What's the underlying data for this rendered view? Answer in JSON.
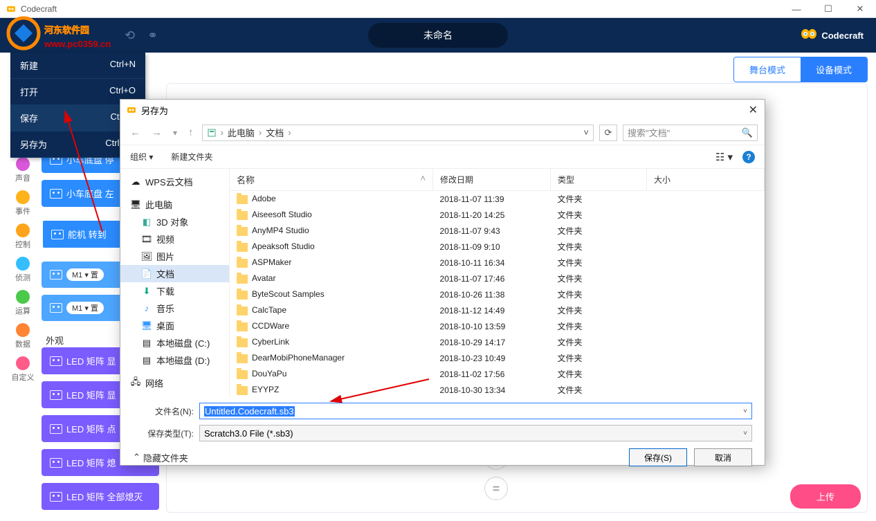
{
  "app": {
    "title": "Codecraft",
    "brand": "Codecraft"
  },
  "header": {
    "project_name": "未命名"
  },
  "mode_tabs": {
    "stage": "舞台模式",
    "device": "设备模式"
  },
  "file_menu": [
    {
      "label": "新建",
      "shortcut": "Ctrl+N"
    },
    {
      "label": "打开",
      "shortcut": "Ctrl+O"
    },
    {
      "label": "保存",
      "shortcut": "Ctrl+S"
    },
    {
      "label": "另存为",
      "shortcut": "Ctrl+Sh"
    }
  ],
  "categories": [
    {
      "label": "外观",
      "color": "#b566ff"
    },
    {
      "label": "声音",
      "color": "#d957d9"
    },
    {
      "label": "事件",
      "color": "#ffb31a"
    },
    {
      "label": "控制",
      "color": "#ffa31a"
    },
    {
      "label": "侦测",
      "color": "#33bfff"
    },
    {
      "label": "运算",
      "color": "#4ac94a"
    },
    {
      "label": "数据",
      "color": "#ff8533"
    },
    {
      "label": "自定义",
      "color": "#ff5c8a"
    }
  ],
  "blocks": {
    "car_stop": "小车底盘 停",
    "car_left": "小车底盘 左",
    "servo": "舵机 转到",
    "m1a": "M1 ▾  置",
    "m1b": "M1 ▾  置",
    "section_appearance": "外观",
    "led1": "LED 矩阵 显",
    "led2": "LED 矩阵 显",
    "led3": "LED 矩阵 点",
    "led4": "LED 矩阵 熄",
    "led5": "LED 矩阵 全部熄灭"
  },
  "upload": "上传",
  "dialog": {
    "title": "另存为",
    "path": {
      "p1": "此电脑",
      "p2": "文档"
    },
    "search_placeholder": "搜索\"文档\"",
    "toolbar": {
      "organize": "组织 ▾",
      "new_folder": "新建文件夹"
    },
    "tree": {
      "wps": "WPS云文档",
      "this_pc": "此电脑",
      "objects3d": "3D 对象",
      "videos": "视频",
      "pictures": "图片",
      "documents": "文档",
      "downloads": "下载",
      "music": "音乐",
      "desktop": "桌面",
      "drive_c": "本地磁盘 (C:)",
      "drive_d": "本地磁盘 (D:)",
      "network": "网络"
    },
    "columns": {
      "name": "名称",
      "date": "修改日期",
      "type": "类型",
      "size": "大小"
    },
    "files": [
      {
        "name": "Adobe",
        "date": "2018-11-07 11:39",
        "type": "文件夹"
      },
      {
        "name": "Aiseesoft Studio",
        "date": "2018-11-20 14:25",
        "type": "文件夹"
      },
      {
        "name": "AnyMP4 Studio",
        "date": "2018-11-07 9:43",
        "type": "文件夹"
      },
      {
        "name": "Apeaksoft Studio",
        "date": "2018-11-09 9:10",
        "type": "文件夹"
      },
      {
        "name": "ASPMaker",
        "date": "2018-10-11 16:34",
        "type": "文件夹"
      },
      {
        "name": "Avatar",
        "date": "2018-11-07 17:46",
        "type": "文件夹"
      },
      {
        "name": "ByteScout Samples",
        "date": "2018-10-26 11:38",
        "type": "文件夹"
      },
      {
        "name": "CalcTape",
        "date": "2018-11-12 14:49",
        "type": "文件夹"
      },
      {
        "name": "CCDWare",
        "date": "2018-10-10 13:59",
        "type": "文件夹"
      },
      {
        "name": "CyberLink",
        "date": "2018-10-29 14:17",
        "type": "文件夹"
      },
      {
        "name": "DearMobiPhoneManager",
        "date": "2018-10-23 10:49",
        "type": "文件夹"
      },
      {
        "name": "DouYaPu",
        "date": "2018-11-02 17:56",
        "type": "文件夹"
      },
      {
        "name": "EYYPZ",
        "date": "2018-10-30 13:34",
        "type": "文件夹"
      }
    ],
    "filename_label": "文件名(N):",
    "filename_value": "Untitled.Codecraft.sb3",
    "filetype_label": "保存类型(T):",
    "filetype_value": "Scratch3.0 File (*.sb3)",
    "hide_folders": "隐藏文件夹",
    "save_btn": "保存(S)",
    "cancel_btn": "取消"
  },
  "watermark": {
    "line1": "河东软件园",
    "line2": "www.pc0359.cn"
  }
}
